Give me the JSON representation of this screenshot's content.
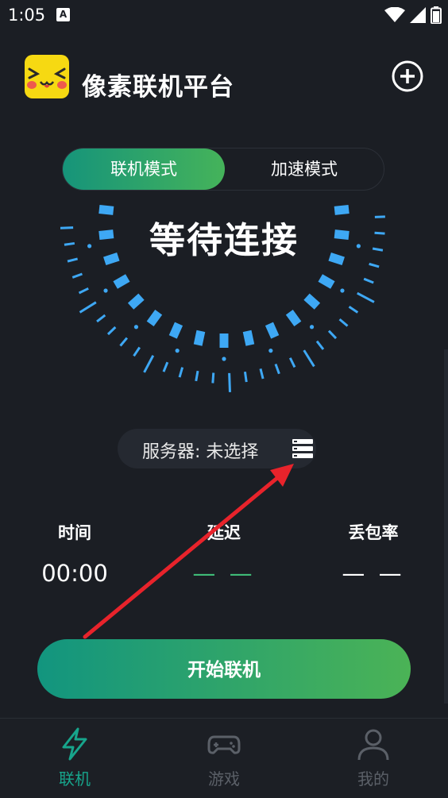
{
  "status_bar": {
    "time": "1:05",
    "notification_glyph": "A",
    "icons": [
      "wifi-icon",
      "signal-icon",
      "battery-icon"
    ]
  },
  "header": {
    "app_title": "像素联机平台",
    "logo_icon": "pikachu-face-icon",
    "add_icon": "plus-circle-icon"
  },
  "modes": {
    "active": "联机模式",
    "inactive": "加速模式"
  },
  "gauge": {
    "status": "等待连接"
  },
  "server": {
    "label": "服务器:  未选择",
    "icon": "server-rack-icon"
  },
  "stats": [
    {
      "label": "时间",
      "value": "00:00"
    },
    {
      "label": "延迟",
      "value": "— —"
    },
    {
      "label": "丢包率",
      "value": "— —"
    }
  ],
  "start_button": "开始联机",
  "nav": [
    {
      "label": "联机",
      "icon": "lightning-icon"
    },
    {
      "label": "游戏",
      "icon": "gamepad-icon"
    },
    {
      "label": "我的",
      "icon": "person-icon"
    }
  ],
  "colors": {
    "background": "#1b1e24",
    "accent_green": "#17a58c",
    "gradient_start": "#12957f",
    "gradient_end": "#4bb356",
    "gauge_blue": "#3ea8f4",
    "arrow_red": "#e8232b"
  }
}
